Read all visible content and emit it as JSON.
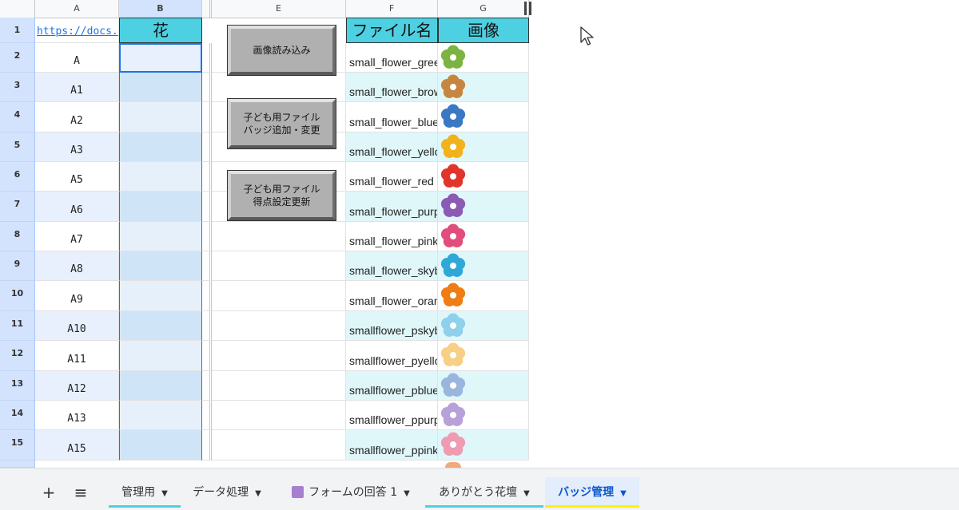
{
  "columns": [
    "A",
    "B",
    "E",
    "F",
    "G"
  ],
  "cells": {
    "a1_link": "https://docs.go",
    "b1_header": "花",
    "f1_header": "ファイル名",
    "g1_header": "画像"
  },
  "buttons": {
    "load_images": "画像読み込み",
    "add_badge": "子ども用ファイル\nバッジ追加・変更",
    "update_score": "子ども用ファイル\n得点設定更新"
  },
  "rows": [
    {
      "num": "1"
    },
    {
      "num": "2",
      "a": "A",
      "f": "small_flower_green",
      "color": "#7cb342"
    },
    {
      "num": "3",
      "a": "A1",
      "f": "small_flower_brown",
      "color": "#c68642"
    },
    {
      "num": "4",
      "a": "A2",
      "f": "small_flower_blue",
      "color": "#3b78c4"
    },
    {
      "num": "5",
      "a": "A3",
      "f": "small_flower_yellow",
      "color": "#f2b21b"
    },
    {
      "num": "6",
      "a": "A5",
      "f": "small_flower_red",
      "color": "#e0352b"
    },
    {
      "num": "7",
      "a": "A6",
      "f": "small_flower_purple",
      "color": "#8a5ab5"
    },
    {
      "num": "8",
      "a": "A7",
      "f": "small_flower_pink",
      "color": "#e24d7b"
    },
    {
      "num": "9",
      "a": "A8",
      "f": "small_flower_skyblue",
      "color": "#2fa8d8"
    },
    {
      "num": "10",
      "a": "A9",
      "f": "small_flower_orange",
      "color": "#ef7d14"
    },
    {
      "num": "11",
      "a": "A10",
      "f": "smallflower_pskyblue",
      "color": "#8fd0ec"
    },
    {
      "num": "12",
      "a": "A11",
      "f": "smallflower_pyellow",
      "color": "#f7cf85"
    },
    {
      "num": "13",
      "a": "A12",
      "f": "smallflower_pblue",
      "color": "#9ab6de"
    },
    {
      "num": "14",
      "a": "A13",
      "f": "smallflower_ppurple",
      "color": "#b8a1d8"
    },
    {
      "num": "15",
      "a": "A15",
      "f": "smallflower_ppink",
      "color": "#ef9bb2"
    }
  ],
  "tabs": {
    "add": "+",
    "menu": "≡",
    "t1": "管理用",
    "t2": "データ処理",
    "t3": "フォームの回答 1",
    "t4": "ありがとう花壇",
    "t5": "バッジ管理",
    "t1_color": "#4dd0e1",
    "t4_color": "#4dd0e1",
    "t5_color": "#fff200",
    "active_tab_bg": "#e3edfb",
    "form_icon_color": "#a77fd1"
  }
}
